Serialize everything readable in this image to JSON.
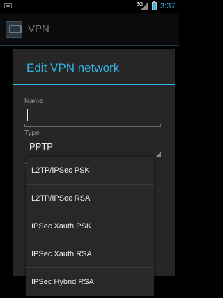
{
  "status_bar": {
    "signal_label": "3G",
    "clock": "3:37",
    "accent_color": "#33b5e5"
  },
  "action_bar": {
    "title": "VPN",
    "app_icon": "vpn-settings-icon"
  },
  "dialog": {
    "title": "Edit VPN network",
    "name_label": "Name",
    "name_value": "",
    "type_label": "Type",
    "type_value": "PPTP",
    "server_label_partial": "S"
  },
  "dropdown": {
    "options": [
      "L2TP/IPSec PSK",
      "L2TP/IPSec RSA",
      "IPSec Xauth PSK",
      "IPSec Xauth RSA",
      "IPSec Hybrid RSA"
    ]
  }
}
